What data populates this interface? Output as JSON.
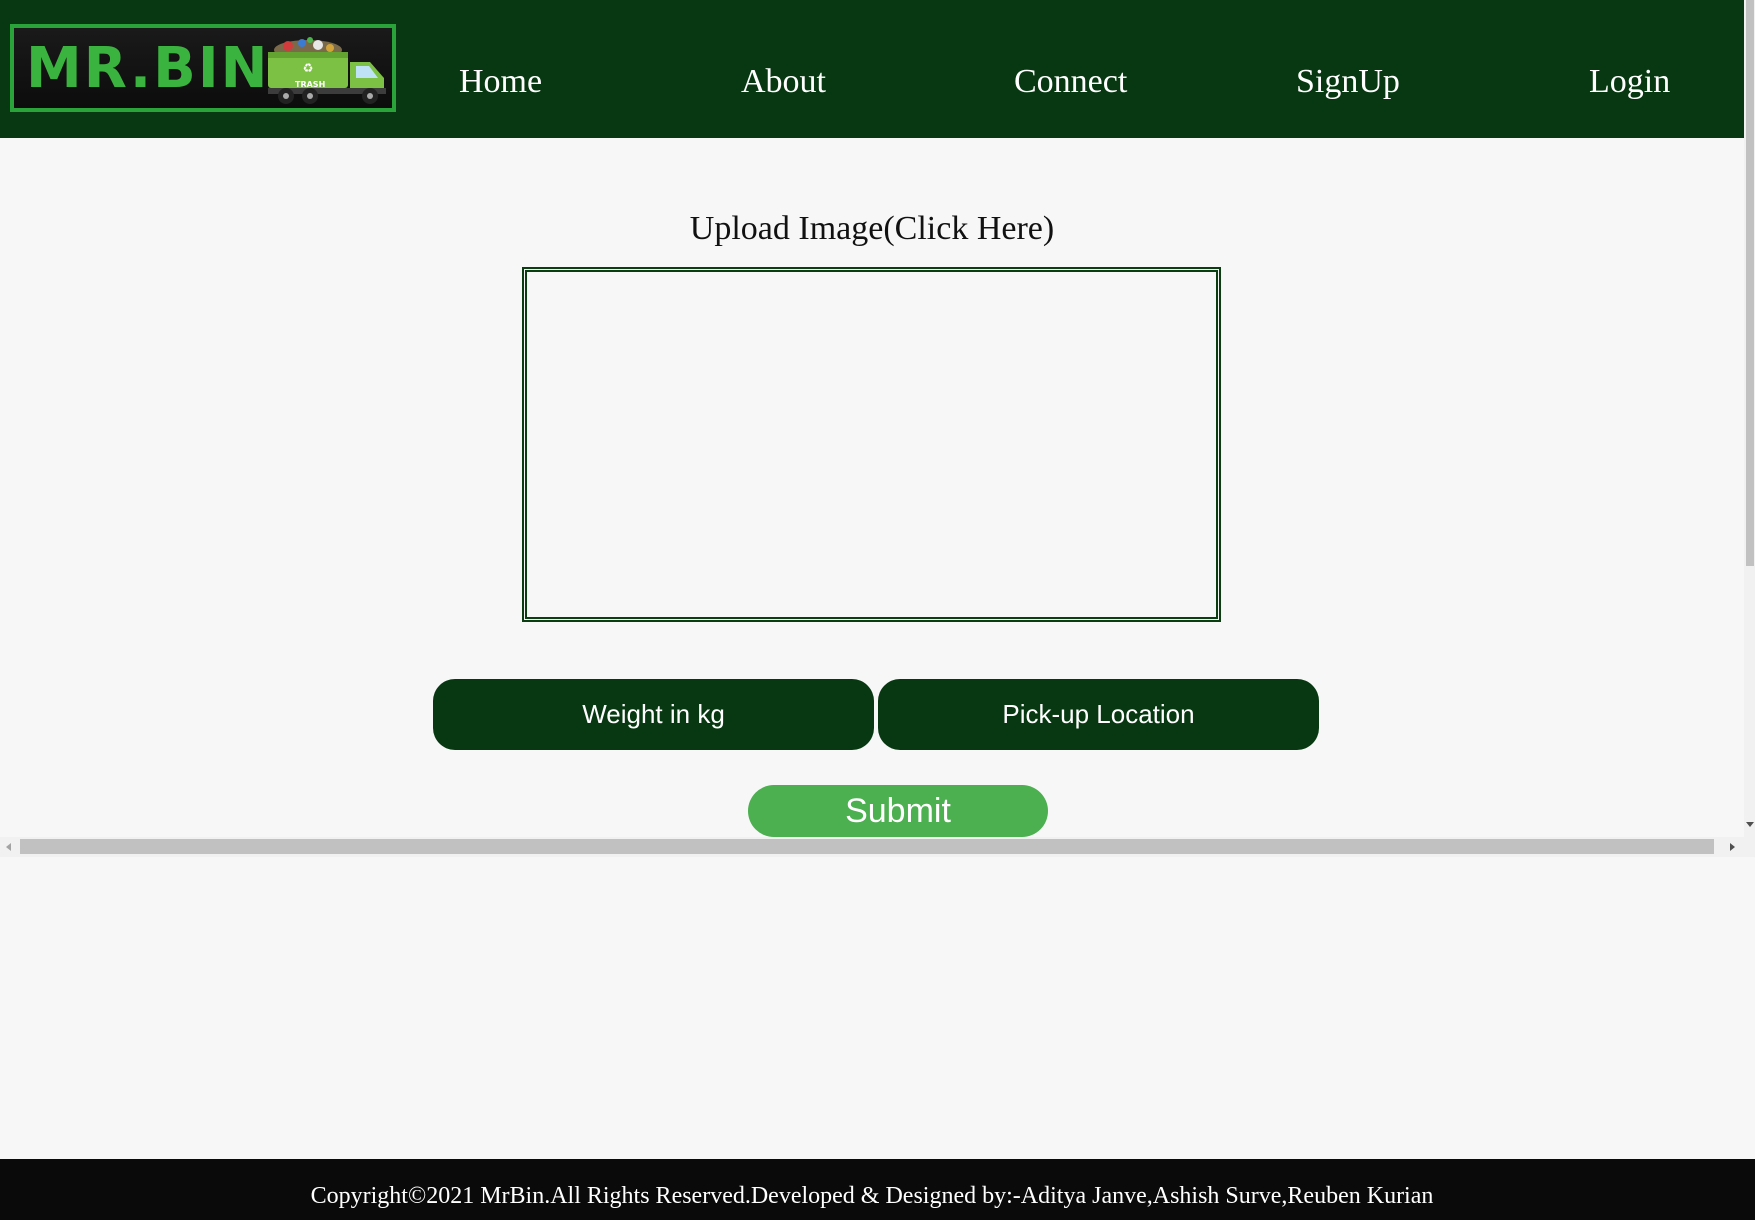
{
  "header": {
    "logo_text": "MR.BIN",
    "logo_badge": "TRASH",
    "nav": [
      {
        "label": "Home"
      },
      {
        "label": "About"
      },
      {
        "label": "Connect"
      },
      {
        "label": "SignUp"
      },
      {
        "label": "Login"
      }
    ]
  },
  "upload": {
    "title": "Upload Image(Click Here)"
  },
  "form": {
    "weight_placeholder": "Weight in kg",
    "location_placeholder": "Pick-up Location",
    "submit_label": "Submit"
  },
  "footer": {
    "text": "Copyright©2021 MrBin.All Rights Reserved.Developed & Designed by:-Aditya Janve,Ashish Surve,Reuben Kurian"
  },
  "colors": {
    "header_bg": "#073811",
    "logo_green": "#3bb33f",
    "submit_bg": "#4caf50",
    "footer_bg": "#0a0a0a",
    "page_bg": "#f7f7f7"
  }
}
